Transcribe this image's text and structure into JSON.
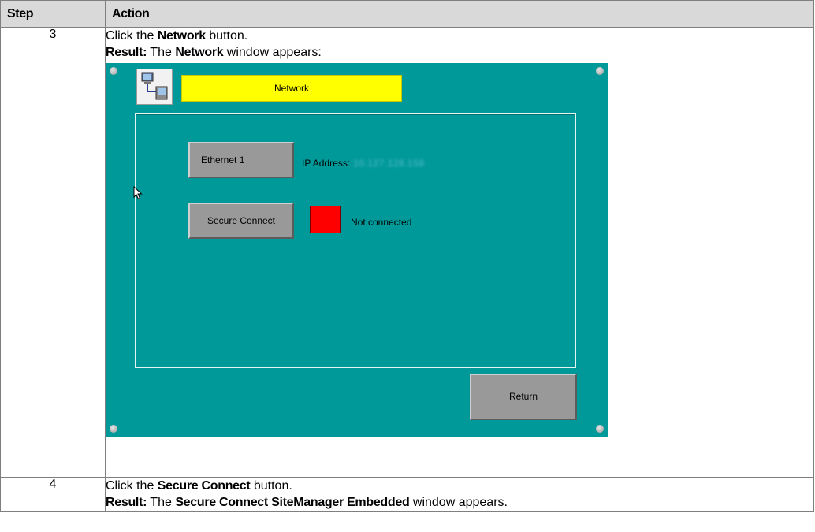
{
  "table": {
    "headers": [
      "Step",
      "Action"
    ],
    "rows": [
      {
        "step": "3",
        "instruction_prefix": "Click the ",
        "instruction_bold": "Network",
        "instruction_suffix": " button.",
        "result_label": "Result:",
        "result_prefix": " The ",
        "result_bold": "Network",
        "result_suffix": " window appears:"
      },
      {
        "step": "4",
        "instruction_prefix": "Click the ",
        "instruction_bold": "Secure Connect",
        "instruction_suffix": " button.",
        "result_label": "Result:",
        "result_prefix": " The ",
        "result_bold": "Secure Connect SiteManager Embedded",
        "result_suffix": " window appears."
      }
    ]
  },
  "hmi": {
    "title": "Network",
    "icon": "network-computers-icon",
    "ethernet_button": "Ethernet 1",
    "ip_label": "IP Address:",
    "ip_value": "10.127.128.158",
    "secure_connect_button": "Secure Connect",
    "status_text": "Not connected",
    "return_button": "Return",
    "colors": {
      "background": "#009999",
      "title_bar": "#ffff00",
      "button": "#999999",
      "status_indicator": "#ff0000"
    }
  }
}
